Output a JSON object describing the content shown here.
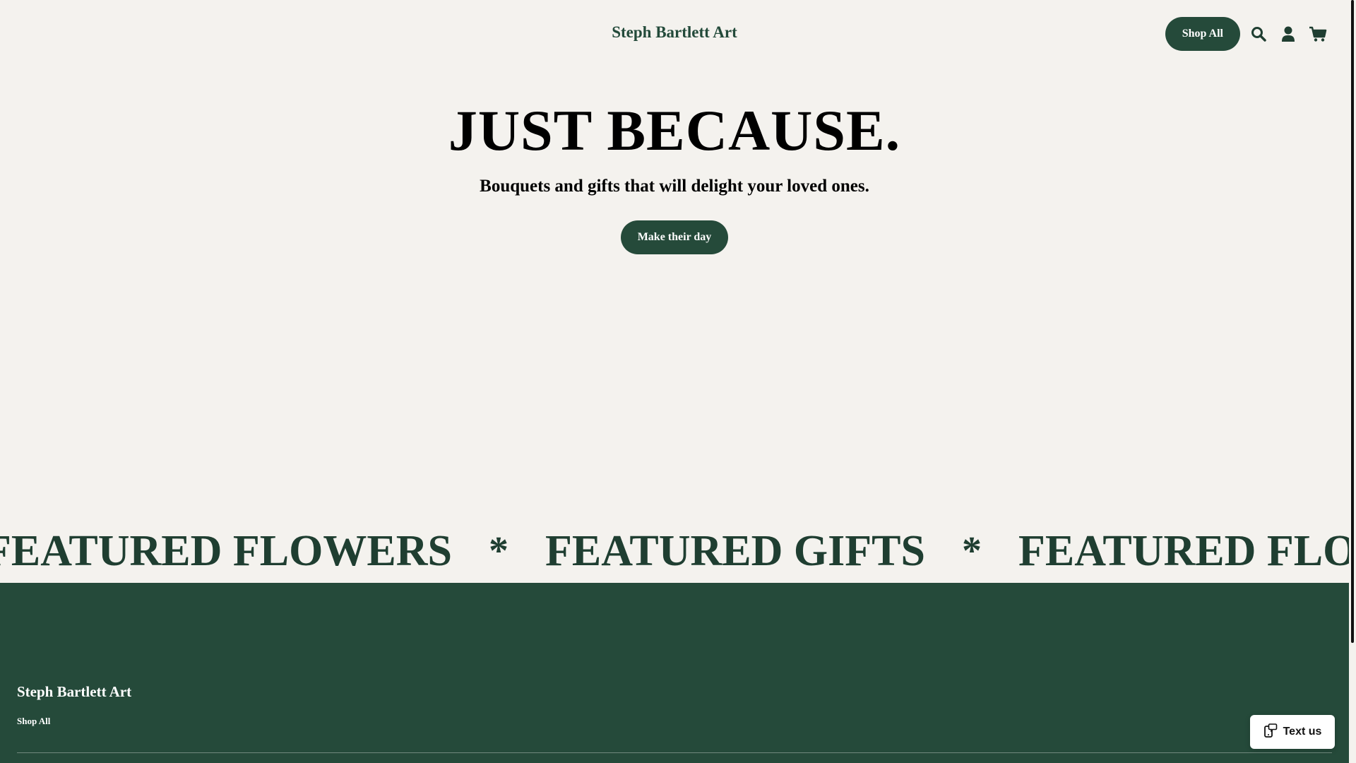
{
  "header": {
    "brand": "Steph Bartlett Art",
    "shop_all_label": "Shop All",
    "icons": [
      "search-icon",
      "account-icon",
      "cart-icon"
    ]
  },
  "hero": {
    "title": "JUST BECAUSE.",
    "subtitle": "Bouquets and gifts that will delight your loved ones.",
    "cta_label": "Make their day"
  },
  "marquee": {
    "items": [
      "FEATURED FLOWERS",
      "*",
      "FEATURED GIFTS",
      "*",
      "FEATURED FLOWERS"
    ]
  },
  "footer": {
    "brand": "Steph Bartlett Art",
    "links": [
      "Shop All"
    ]
  },
  "chat_widget": {
    "label": "Text us",
    "icon": "phone-message-icon"
  },
  "colors": {
    "background": "#f4f2ee",
    "brand_green": "#254a3a",
    "marquee_text": "#1f3e31",
    "text": "#000000"
  }
}
